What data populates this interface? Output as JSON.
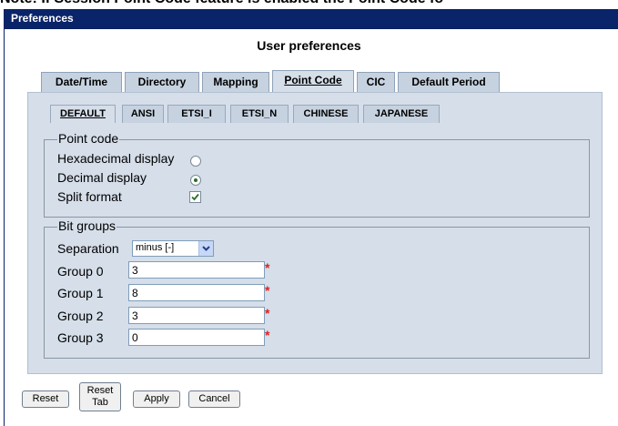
{
  "top_note": "Note: If Session Point Code feature is enabled the Point Code fo",
  "window": {
    "title": "Preferences"
  },
  "heading": "User preferences",
  "tabs": [
    {
      "label": "Date/Time",
      "active": false
    },
    {
      "label": "Directory",
      "active": false
    },
    {
      "label": "Mapping",
      "active": false
    },
    {
      "label": "Point Code",
      "active": true
    },
    {
      "label": "CIC",
      "active": false
    },
    {
      "label": "Default Period",
      "active": false
    }
  ],
  "subtabs": [
    {
      "label": "DEFAULT",
      "active": true
    },
    {
      "label": "ANSI",
      "active": false
    },
    {
      "label": "ETSI_I",
      "active": false
    },
    {
      "label": "ETSI_N",
      "active": false
    },
    {
      "label": "CHINESE",
      "active": false
    },
    {
      "label": "JAPANESE",
      "active": false
    }
  ],
  "point_code": {
    "legend": "Point code",
    "hex_label": "Hexadecimal display",
    "hex_selected": false,
    "dec_label": "Decimal display",
    "dec_selected": true,
    "split_label": "Split format",
    "split_checked": true
  },
  "bit_groups": {
    "legend": "Bit groups",
    "separation_label": "Separation",
    "separation_value": "minus [-]",
    "groups": [
      {
        "label": "Group 0",
        "value": "3",
        "required_mark": "*"
      },
      {
        "label": "Group 1",
        "value": "8",
        "required_mark": "*"
      },
      {
        "label": "Group 2",
        "value": "3",
        "required_mark": "*"
      },
      {
        "label": "Group 3",
        "value": "0",
        "required_mark": "*"
      }
    ]
  },
  "buttons": {
    "reset": "Reset",
    "reset_tab_line1": "Reset",
    "reset_tab_line2": "Tab",
    "apply": "Apply",
    "cancel": "Cancel"
  },
  "colors": {
    "titlebar": "#0a246a",
    "panel": "#d5dee9",
    "tab": "#c6d2e0",
    "required": "#e02020",
    "radio_selected": "#2a6e2a"
  }
}
